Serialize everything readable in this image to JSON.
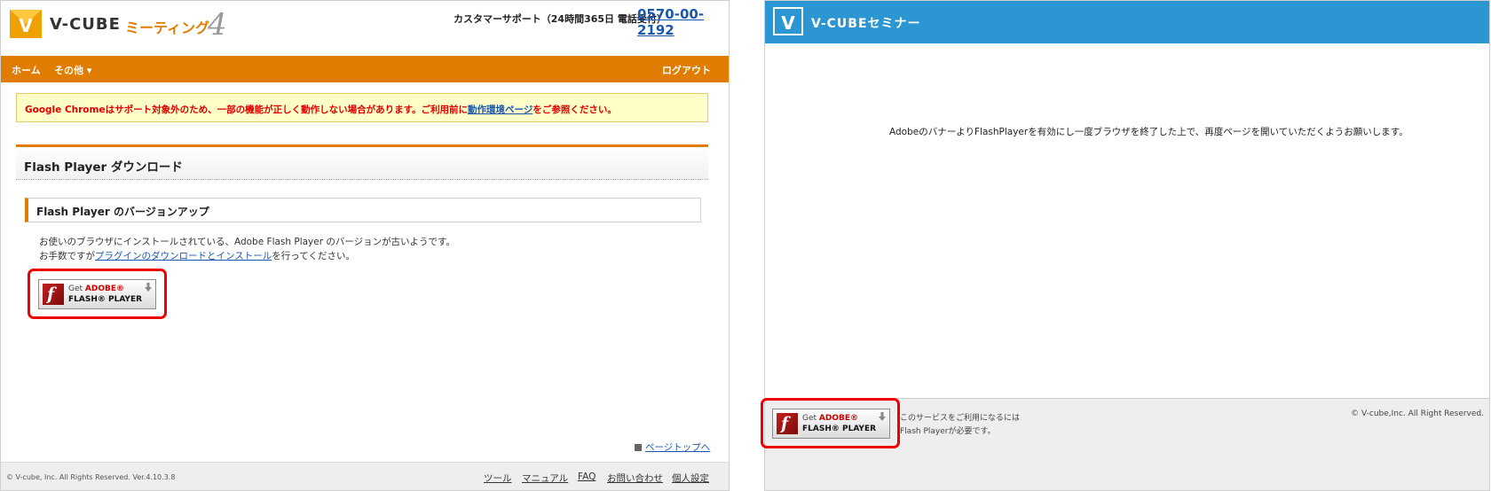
{
  "left": {
    "logo": {
      "brand": "V-CUBE",
      "product": "ミーティング",
      "version": "4"
    },
    "support": {
      "text": "カスタマーサポート（24時間365日 電話受付）",
      "phone": "0570-00-2192"
    },
    "nav": {
      "home": "ホーム",
      "other": "その他 ▾",
      "logout": "ログアウト"
    },
    "warning": {
      "prefix": "Google Chromeはサポート対象外のため、一部の機能が正しく動作しない場合があります。ご利用前に",
      "link": "動作環境ページ",
      "suffix": "をご参照ください。"
    },
    "section_title": "Flash Player ダウンロード",
    "sub_title": "Flash Player のバージョンアップ",
    "body": {
      "line1": "お使いのブラウザにインストールされている、Adobe Flash Player のバージョンが古いようです。",
      "line2_prefix": "お手数ですが",
      "line2_link": "プラグインのダウンロードとインストール",
      "line2_suffix": "を行ってください。"
    },
    "flash_button": {
      "get": "Get ",
      "adobe": "ADOBE®",
      "player": "FLASH® PLAYER",
      "icon_letter": "f"
    },
    "page_top": "ページトップへ",
    "footer": {
      "copyright": "© V-cube, Inc. All Rights Reserved.   Ver.4.10.3.8",
      "links": {
        "tool": "ツール",
        "manual": "マニュアル",
        "faq": "FAQ",
        "contact": "お問い合わせ",
        "personal": "個人設定"
      }
    }
  },
  "right": {
    "logo": {
      "text": "V-CUBEセミナー"
    },
    "message": "AdobeのバナーよりFlashPlayerを有効にし一度ブラウザを終了した上で、再度ページを開いていただくようお願いします。",
    "flash_button": {
      "get": "Get ",
      "adobe": "ADOBE®",
      "player": "FLASH® PLAYER",
      "icon_letter": "f"
    },
    "footer": {
      "line1": "このサービスをご利用になるには",
      "line2": "Flash Playerが必要です。",
      "copyright": "© V-cube,Inc. All Right Reserved."
    }
  },
  "colors": {
    "accent_orange": "#e07c00",
    "seminar_blue": "#2b96d1",
    "highlight_red": "#ee0000",
    "link_blue": "#1a58b0",
    "warning_red": "#e00000"
  },
  "icons": [
    "v-cube-logo-icon",
    "flash-player-icon",
    "download-arrow-icon",
    "page-top-icon"
  ]
}
